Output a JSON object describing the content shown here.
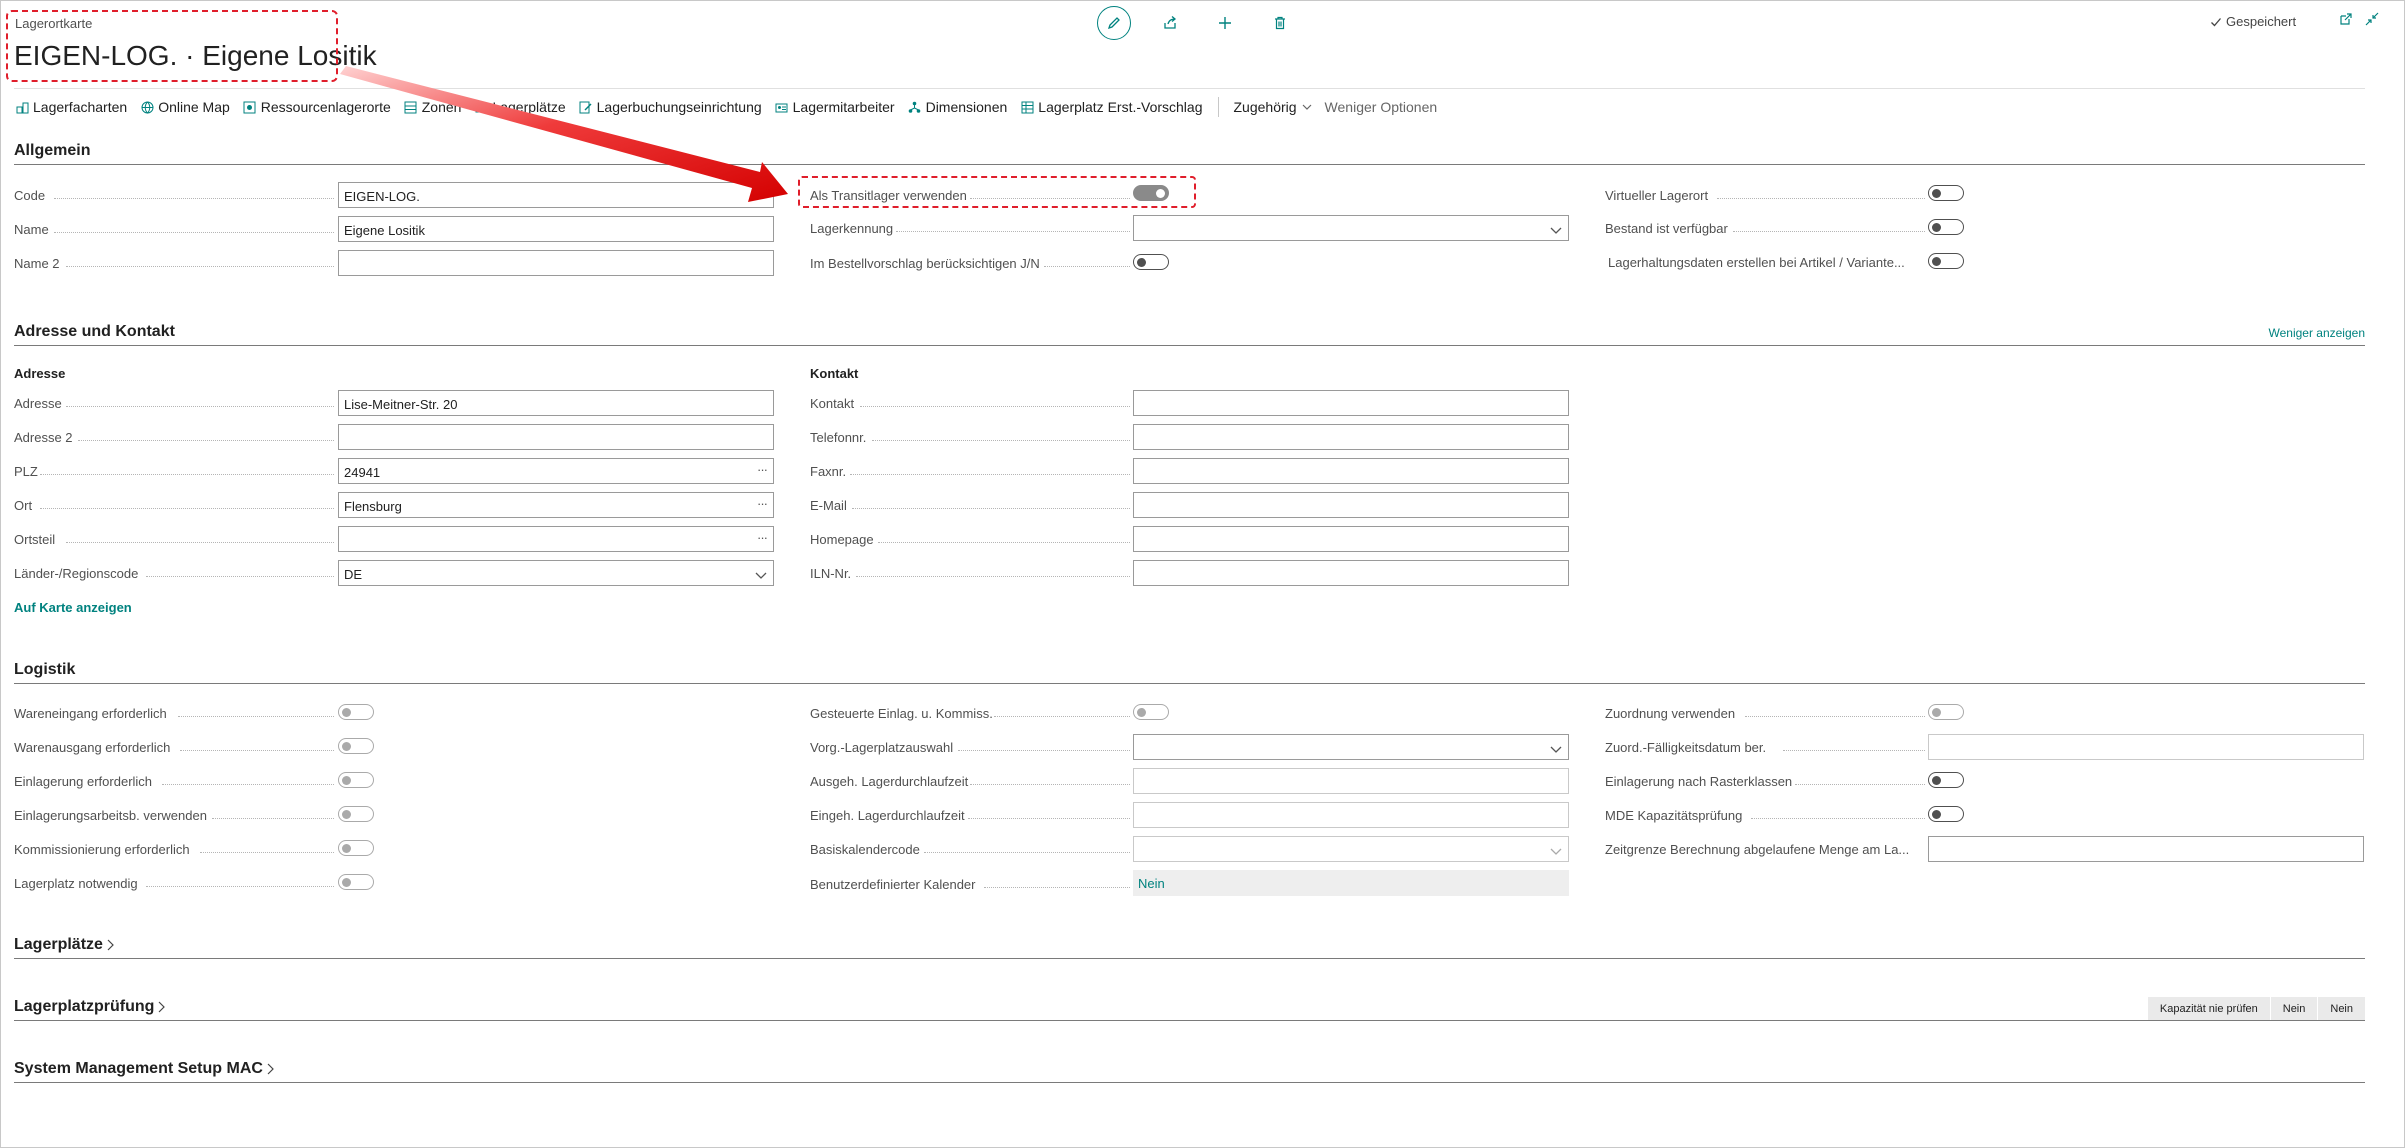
{
  "header": {
    "caption": "Lagerortkarte",
    "title": "EIGEN-LOG. · Eigene Lositik",
    "saved_label": "Gespeichert"
  },
  "top_icons": [
    "edit-icon",
    "share-icon",
    "add-icon",
    "delete-icon"
  ],
  "actions": [
    {
      "label": "Lagerfacharten",
      "icon": "bin-types-icon"
    },
    {
      "label": "Online Map",
      "icon": "globe-icon"
    },
    {
      "label": "Ressourcenlagerorte",
      "icon": "resource-icon"
    },
    {
      "label": "Zonen",
      "icon": "zones-icon"
    },
    {
      "label": "Lagerplätze",
      "icon": "bins-icon"
    },
    {
      "label": "Lagerbuchungseinrichtung",
      "icon": "setup-icon"
    },
    {
      "label": "Lagermitarbeiter",
      "icon": "employee-icon"
    },
    {
      "label": "Dimensionen",
      "icon": "dimensions-icon"
    },
    {
      "label": "Lagerplatz Erst.-Vorschlag",
      "icon": "worksheet-icon"
    }
  ],
  "related_label": "Zugehörig",
  "fewer_options_label": "Weniger Optionen",
  "allgemein": {
    "title": "Allgemein",
    "code_label": "Code",
    "code_value": "EIGEN-LOG.",
    "name_label": "Name",
    "name_value": "Eigene Lositik",
    "name2_label": "Name 2",
    "name2_value": "",
    "transit_label": "Als Transitlager verwenden",
    "lagerkennung_label": "Lagerkennung",
    "lagerkennung_value": "",
    "bestellvorschlag_label": "Im Bestellvorschlag berücksichtigen J/N",
    "virtuell_label": "Virtueller Lagerort",
    "bestand_label": "Bestand ist verfügbar",
    "lagerhaltung_label": "Lagerhaltungsdaten erstellen bei Artikel / Variante..."
  },
  "adresse": {
    "title": "Adresse und Kontakt",
    "show_less": "Weniger anzeigen",
    "adresse_head": "Adresse",
    "kontakt_head": "Kontakt",
    "adresse_label": "Adresse",
    "adresse_value": "Lise-Meitner-Str. 20",
    "adresse2_label": "Adresse 2",
    "adresse2_value": "",
    "plz_label": "PLZ",
    "plz_value": "24941",
    "ort_label": "Ort",
    "ort_value": "Flensburg",
    "ortsteil_label": "Ortsteil",
    "ortsteil_value": "",
    "land_label": "Länder-/Regionscode",
    "land_value": "DE",
    "kontakt_label": "Kontakt",
    "kontakt_value": "",
    "telefon_label": "Telefonnr.",
    "telefon_value": "",
    "fax_label": "Faxnr.",
    "fax_value": "",
    "email_label": "E-Mail",
    "email_value": "",
    "homepage_label": "Homepage",
    "homepage_value": "",
    "iln_label": "ILN-Nr.",
    "iln_value": "",
    "map_link": "Auf Karte anzeigen"
  },
  "logistik": {
    "title": "Logistik",
    "wareneingang_label": "Wareneingang erforderlich",
    "warenausgang_label": "Warenausgang erforderlich",
    "einlagerung_label": "Einlagerung erforderlich",
    "einlagerungsarbeit_label": "Einlagerungsarbeitsb. verwenden",
    "kommissionierung_label": "Kommissionierung erforderlich",
    "lagerplatz_label": "Lagerplatz notwendig",
    "gesteuerte_label": "Gesteuerte Einlag. u. Kommiss.",
    "vorg_label": "Vorg.-Lagerplatzauswahl",
    "vorg_value": "",
    "ausgeh_label": "Ausgeh. Lagerdurchlaufzeit",
    "ausgeh_value": "",
    "eingeh_label": "Eingeh. Lagerdurchlaufzeit",
    "eingeh_value": "",
    "basiskal_label": "Basiskalendercode",
    "basiskal_value": "",
    "benutzer_label": "Benutzerdefinierter Kalender",
    "benutzer_value": "Nein",
    "zuordnung_label": "Zuordnung verwenden",
    "zuord_datum_label": "Zuord.-Fälligkeitsdatum ber.",
    "zuord_datum_value": "",
    "raster_label": "Einlagerung nach Rasterklassen",
    "mde_label": "MDE Kapazitätsprüfung",
    "zeitgrenze_label": "Zeitgrenze Berechnung abgelaufene Menge am La...",
    "zeitgrenze_value": ""
  },
  "lagerplaetze": {
    "title": "Lagerplätze"
  },
  "lagerplatzpruefung": {
    "title": "Lagerplatzprüfung",
    "summary": [
      "Kapazität nie prüfen",
      "Nein",
      "Nein"
    ]
  },
  "smsetup": {
    "title": "System Management Setup MAC"
  },
  "colors": {
    "accent": "#00827f",
    "highlight": "#e01e2b"
  }
}
